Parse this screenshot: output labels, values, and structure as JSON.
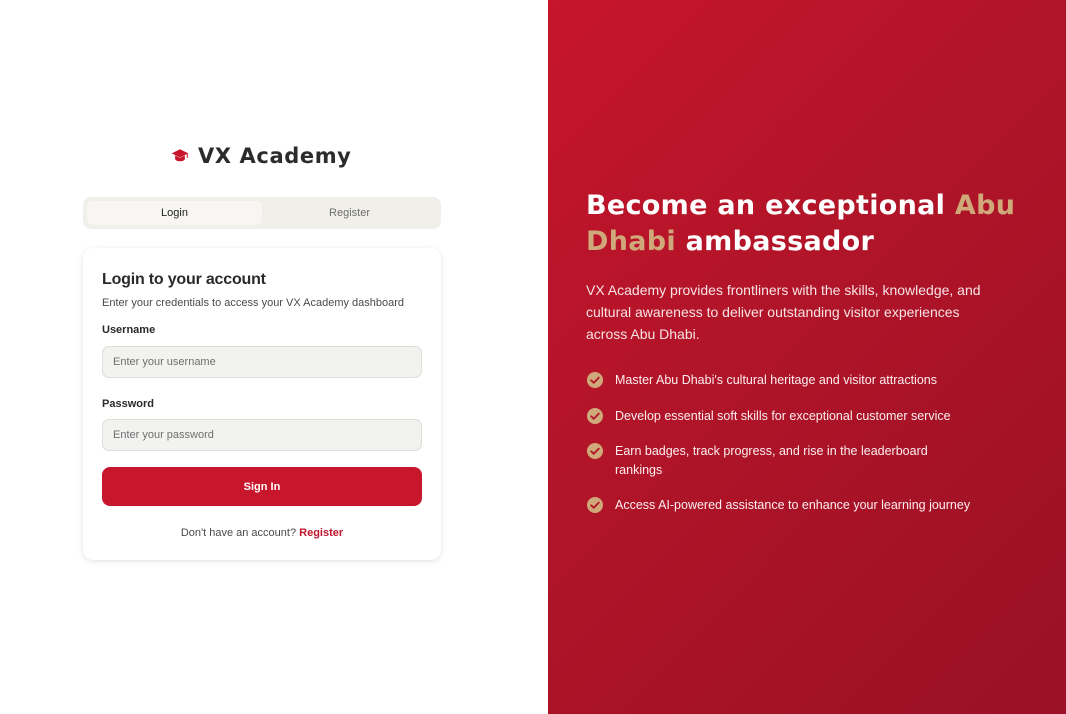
{
  "brand": {
    "name": "VX Academy",
    "icon": "graduation-cap-icon",
    "accent_color": "#c8162d"
  },
  "tabs": {
    "login": "Login",
    "register": "Register"
  },
  "login_card": {
    "title": "Login to your account",
    "subtitle": "Enter your credentials to access your VX Academy dashboard",
    "username_label": "Username",
    "username_placeholder": "Enter your username",
    "password_label": "Password",
    "password_placeholder": "Enter your password",
    "submit_label": "Sign In",
    "footer_text": "Don't have an account?",
    "footer_link": "Register"
  },
  "hero": {
    "headline_before": "Become an exceptional ",
    "headline_highlight": "Abu Dhabi",
    "headline_after": " ambassador",
    "highlight_color": "#cfa97a",
    "background_color": "#b01428",
    "description": "VX Academy provides frontliners with the skills, knowledge, and cultural awareness to deliver outstanding visitor experiences across Abu Dhabi.",
    "features": [
      "Master Abu Dhabi's cultural heritage and visitor attractions",
      "Develop essential soft skills for exceptional customer service",
      "Earn badges, track progress, and rise in the leaderboard rankings",
      "Access AI-powered assistance to enhance your learning journey"
    ],
    "feature_icon": "check-circle-icon"
  }
}
